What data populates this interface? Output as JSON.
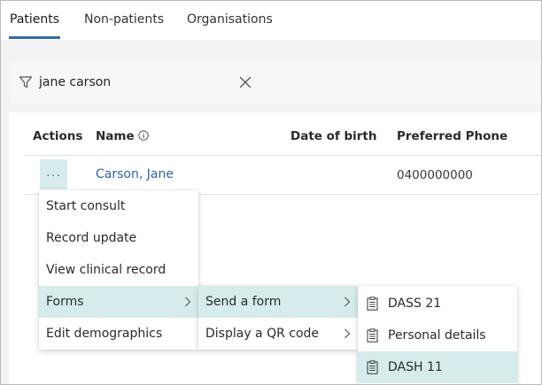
{
  "tabs": [
    {
      "label": "Patients",
      "active": true
    },
    {
      "label": "Non-patients",
      "active": false
    },
    {
      "label": "Organisations",
      "active": false
    }
  ],
  "filter": {
    "value": "jane carson",
    "icon": "filter-icon",
    "clear_icon": "close-icon"
  },
  "table": {
    "headers": {
      "actions": "Actions",
      "name": "Name",
      "dob": "Date of birth",
      "phone": "Preferred Phone"
    },
    "row": {
      "actions_label": "···",
      "name": "Carson, Jane",
      "dob": "",
      "phone": "0400000000"
    }
  },
  "actions_menu": {
    "items": [
      {
        "label": "Start consult"
      },
      {
        "label": "Record update"
      },
      {
        "label": "View clinical record"
      },
      {
        "label": "Forms",
        "has_submenu": true,
        "highlighted": true
      },
      {
        "label": "Edit demographics"
      }
    ]
  },
  "forms_menu": {
    "items": [
      {
        "label": "Send a form",
        "has_submenu": true,
        "highlighted": true
      },
      {
        "label": "Display a QR code",
        "has_submenu": true
      }
    ]
  },
  "send_form_menu": {
    "items": [
      {
        "label": "DASS 21",
        "icon": "clipboard-icon"
      },
      {
        "label": "Personal details",
        "icon": "clipboard-icon"
      },
      {
        "label": "DASH 11",
        "icon": "clipboard-icon",
        "highlighted": true
      }
    ]
  },
  "colors": {
    "accent": "#2e6da4",
    "link": "#2b63a8",
    "highlight": "#d6ecec",
    "page_bg": "#f3f3f3"
  }
}
